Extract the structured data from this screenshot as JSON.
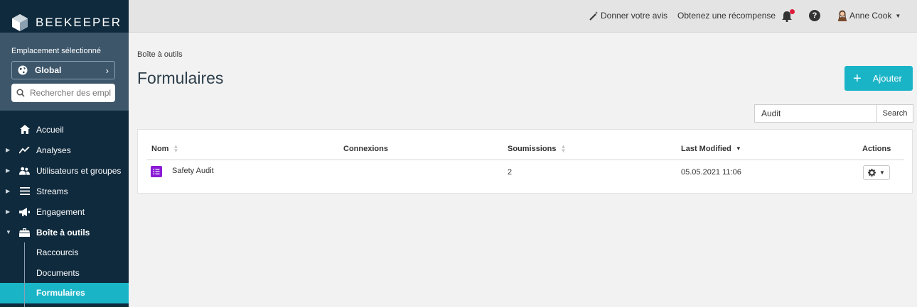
{
  "brand": {
    "name": "BEEKEEPER"
  },
  "location": {
    "label": "Emplacement sélectionné",
    "selected": "Global",
    "search_placeholder": "Rechercher des emplac"
  },
  "nav": {
    "items": [
      {
        "label": "Accueil",
        "icon": "home-icon"
      },
      {
        "label": "Analyses",
        "icon": "chart-line-icon"
      },
      {
        "label": "Utilisateurs et groupes",
        "icon": "users-icon"
      },
      {
        "label": "Streams",
        "icon": "list-icon"
      },
      {
        "label": "Engagement",
        "icon": "megaphone-icon"
      },
      {
        "label": "Boîte à outils",
        "icon": "toolbox-icon"
      }
    ],
    "sub_items": [
      {
        "label": "Raccourcis"
      },
      {
        "label": "Documents"
      },
      {
        "label": "Formulaires",
        "active": true
      }
    ]
  },
  "topbar": {
    "feedback": "Donner votre avis",
    "reward": "Obtenez une récompense",
    "user": "Anne Cook"
  },
  "main": {
    "breadcrumb": "Boîte à outils",
    "title": "Formulaires",
    "add_label": "Ajouter",
    "search_value": "Audit",
    "search_button": "Search"
  },
  "table": {
    "headers": {
      "name": "Nom",
      "connections": "Connexions",
      "submissions": "Soumissions",
      "last_modified": "Last Modified",
      "actions": "Actions"
    },
    "rows": [
      {
        "name": "Safety Audit",
        "connections": "",
        "submissions": "2",
        "last_modified": "05.05.2021 11:06"
      }
    ]
  },
  "colors": {
    "accent": "#1ab4c7",
    "sidebar": "#0f2a3d",
    "form_icon": "#8a1ad6",
    "notification": "#e01b3c"
  }
}
